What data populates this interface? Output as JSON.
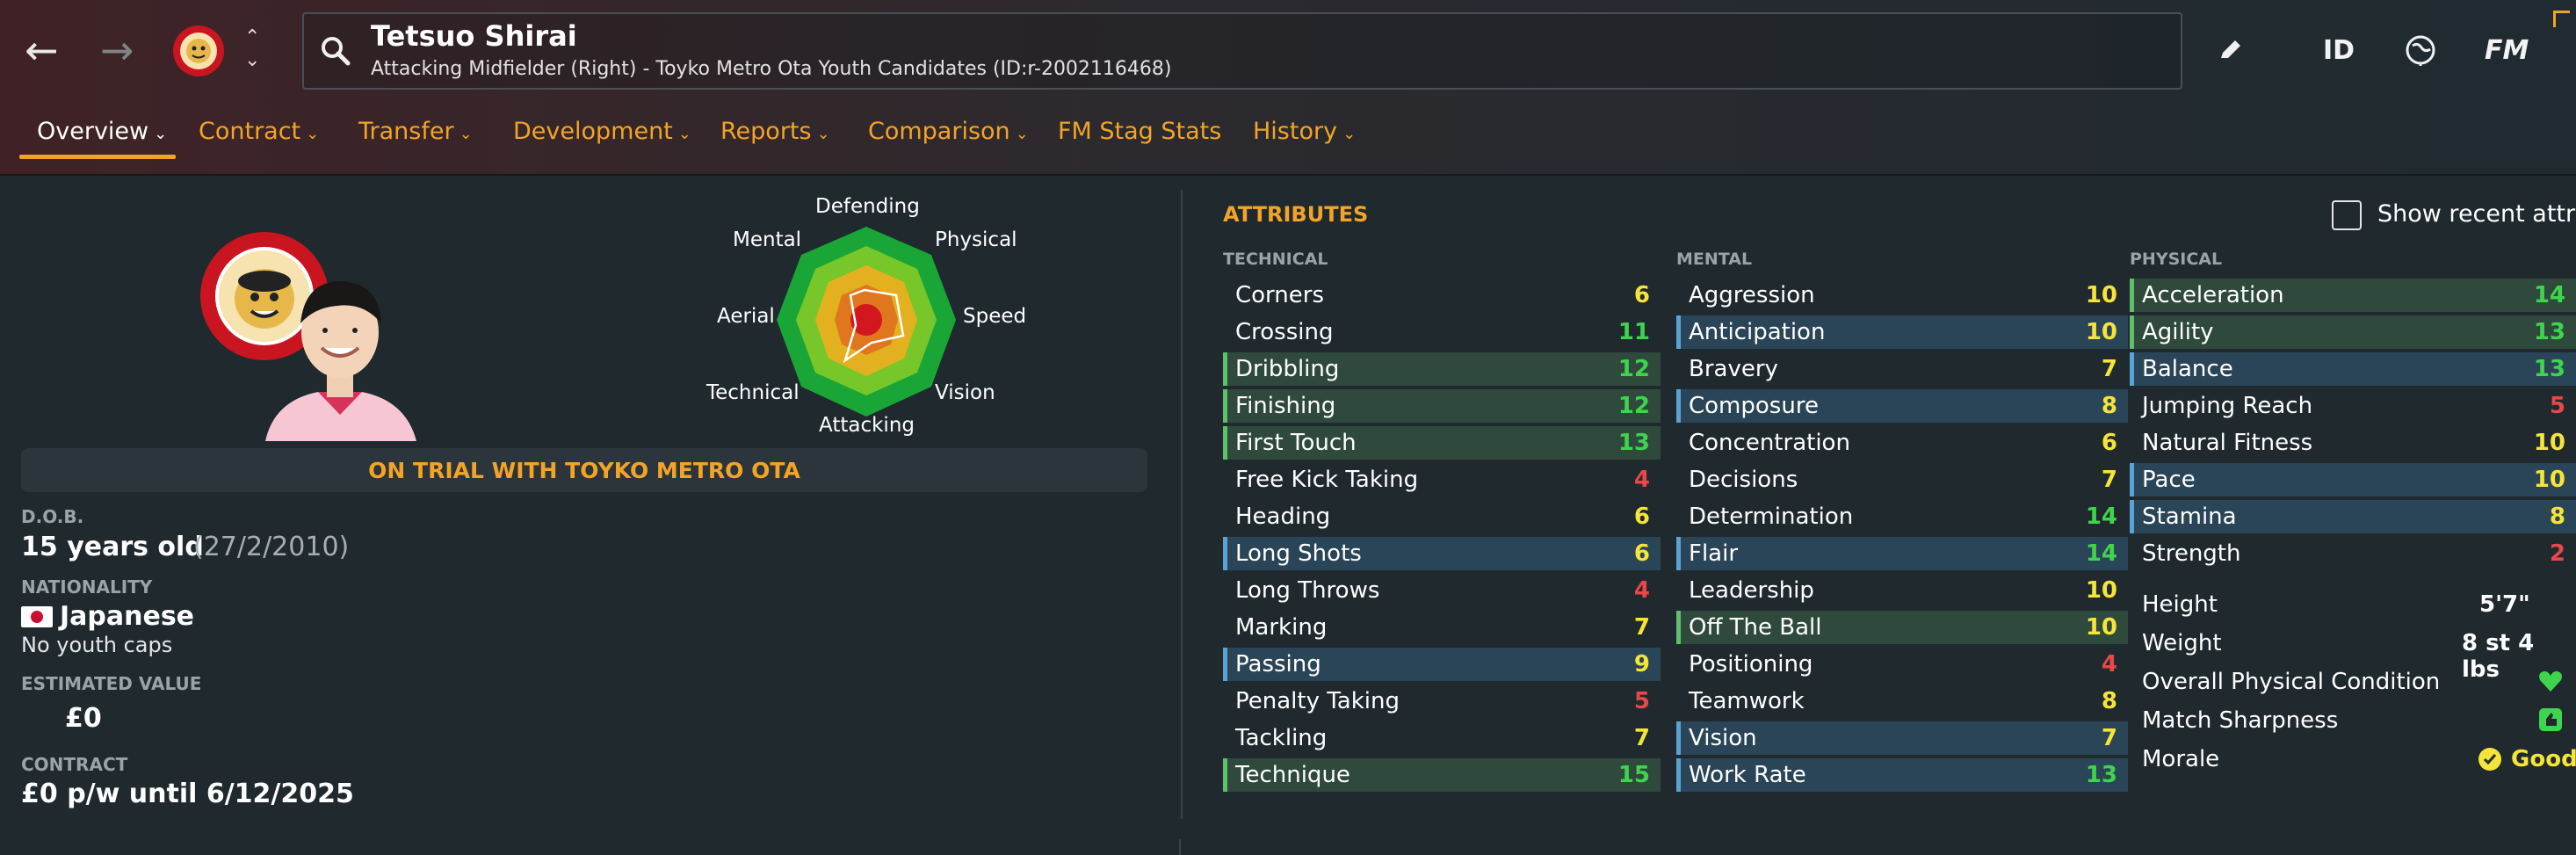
{
  "header": {
    "player_name": "Tetsuo Shirai",
    "player_subtitle": "Attacking Midfielder (Right) - Toyko Metro Ota Youth Candidates (ID:r-2002116468)",
    "id_label": "ID",
    "fm_label": "FM"
  },
  "tabs": [
    {
      "label": "Overview",
      "has_menu": true
    },
    {
      "label": "Contract",
      "has_menu": true
    },
    {
      "label": "Transfer",
      "has_menu": true
    },
    {
      "label": "Development",
      "has_menu": true
    },
    {
      "label": "Reports",
      "has_menu": true
    },
    {
      "label": "Comparison",
      "has_menu": true
    },
    {
      "label": "FM Stag Stats",
      "has_menu": false
    },
    {
      "label": "History",
      "has_menu": true
    }
  ],
  "radar": {
    "labels": [
      "Defending",
      "Physical",
      "Speed",
      "Vision",
      "Attacking",
      "Technical",
      "Aerial",
      "Mental"
    ]
  },
  "trial_banner": "ON TRIAL WITH TOYKO METRO OTA",
  "profile": {
    "dob_label": "D.O.B.",
    "age": "15 years old",
    "dob": "(27/2/2010)",
    "nationality_label": "NATIONALITY",
    "nationality": "Japanese",
    "youth_caps": "No youth caps",
    "value_label": "ESTIMATED VALUE",
    "value": "£0",
    "contract_label": "CONTRACT",
    "contract": "£0 p/w until 6/12/2025"
  },
  "attributes": {
    "title": "ATTRIBUTES",
    "show_recent_label": "Show recent attrib",
    "technical_label": "TECHNICAL",
    "mental_label": "MENTAL",
    "physical_label": "PHYSICAL",
    "technical": [
      {
        "name": "Corners",
        "value": "6"
      },
      {
        "name": "Crossing",
        "value": "11"
      },
      {
        "name": "Dribbling",
        "value": "12"
      },
      {
        "name": "Finishing",
        "value": "12"
      },
      {
        "name": "First Touch",
        "value": "13"
      },
      {
        "name": "Free Kick Taking",
        "value": "4"
      },
      {
        "name": "Heading",
        "value": "6"
      },
      {
        "name": "Long Shots",
        "value": "6"
      },
      {
        "name": "Long Throws",
        "value": "4"
      },
      {
        "name": "Marking",
        "value": "7"
      },
      {
        "name": "Passing",
        "value": "9"
      },
      {
        "name": "Penalty Taking",
        "value": "5"
      },
      {
        "name": "Tackling",
        "value": "7"
      },
      {
        "name": "Technique",
        "value": "15"
      }
    ],
    "mental": [
      {
        "name": "Aggression",
        "value": "10"
      },
      {
        "name": "Anticipation",
        "value": "10"
      },
      {
        "name": "Bravery",
        "value": "7"
      },
      {
        "name": "Composure",
        "value": "8"
      },
      {
        "name": "Concentration",
        "value": "6"
      },
      {
        "name": "Decisions",
        "value": "7"
      },
      {
        "name": "Determination",
        "value": "14"
      },
      {
        "name": "Flair",
        "value": "14"
      },
      {
        "name": "Leadership",
        "value": "10"
      },
      {
        "name": "Off The Ball",
        "value": "10"
      },
      {
        "name": "Positioning",
        "value": "4"
      },
      {
        "name": "Teamwork",
        "value": "8"
      },
      {
        "name": "Vision",
        "value": "7"
      },
      {
        "name": "Work Rate",
        "value": "13"
      }
    ],
    "physical": [
      {
        "name": "Acceleration",
        "value": "14"
      },
      {
        "name": "Agility",
        "value": "13"
      },
      {
        "name": "Balance",
        "value": "13"
      },
      {
        "name": "Jumping Reach",
        "value": "5"
      },
      {
        "name": "Natural Fitness",
        "value": "10"
      },
      {
        "name": "Pace",
        "value": "10"
      },
      {
        "name": "Stamina",
        "value": "8"
      },
      {
        "name": "Strength",
        "value": "2"
      }
    ],
    "body": {
      "height_label": "Height",
      "height": "5'7\"",
      "weight_label": "Weight",
      "weight": "8 st 4 lbs",
      "condition_label": "Overall Physical Condition",
      "sharpness_label": "Match Sharpness",
      "morale_label": "Morale",
      "morale": "Good"
    }
  },
  "colors": {
    "accent": "#f2a427",
    "low": "#e8474b",
    "mid": "#f5e43a",
    "high": "#3fd44e"
  }
}
